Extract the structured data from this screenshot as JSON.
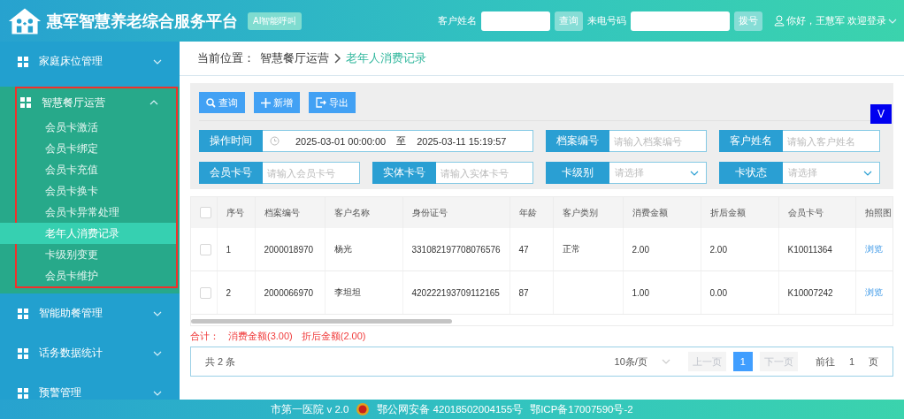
{
  "header": {
    "title": "惠军智慧养老综合服务平台",
    "ai_button": "AI智能呼叫",
    "customer_label": "客户姓名",
    "query_button": "查询",
    "phone_label": "来电号码",
    "dial_button": "拨号",
    "user_greeting": "你好，王慧军 欢迎登录"
  },
  "sidebar": {
    "items": [
      {
        "label": "家庭床位管理",
        "expanded": false
      },
      {
        "label": "智慧餐厅运营",
        "expanded": true,
        "annotated": true,
        "children": [
          {
            "label": "会员卡激活",
            "selected": false
          },
          {
            "label": "会员卡绑定",
            "selected": false
          },
          {
            "label": "会员卡充值",
            "selected": false
          },
          {
            "label": "会员卡换卡",
            "selected": false
          },
          {
            "label": "会员卡异常处理",
            "selected": false
          },
          {
            "label": "老年人消费记录",
            "selected": true
          },
          {
            "label": "卡级别变更",
            "selected": false
          },
          {
            "label": "会员卡维护",
            "selected": false
          }
        ]
      },
      {
        "label": "智能助餐管理",
        "expanded": false
      },
      {
        "label": "话务数据统计",
        "expanded": false
      },
      {
        "label": "预警管理",
        "expanded": false
      }
    ]
  },
  "breadcrumb": {
    "prefix": "当前位置：",
    "parent": "智慧餐厅运营",
    "current": "老年人消费记录"
  },
  "toolbar": {
    "buttons": [
      {
        "kind": "search",
        "label": "查询"
      },
      {
        "kind": "add",
        "label": "新增"
      },
      {
        "kind": "export",
        "label": "导出"
      }
    ],
    "corner_button": "V"
  },
  "filters": [
    {
      "kind": "daterange",
      "label": "操作时间",
      "start": "2025-03-01 00:00:00",
      "separator": "至",
      "end": "2025-03-11 15:19:57"
    },
    {
      "kind": "text",
      "label": "档案编号",
      "placeholder": "请输入档案编号"
    },
    {
      "kind": "text",
      "label": "客户姓名",
      "placeholder": "请输入客户姓名"
    },
    {
      "kind": "text",
      "label": "会员卡号",
      "placeholder": "请输入会员卡号"
    },
    {
      "kind": "text",
      "label": "实体卡号",
      "placeholder": "请输入实体卡号"
    },
    {
      "kind": "select",
      "label": "卡级别",
      "placeholder": "请选择"
    },
    {
      "kind": "select",
      "label": "卡状态",
      "placeholder": "请选择"
    }
  ],
  "table": {
    "all_checked": false,
    "columns": [
      "序号",
      "档案编号",
      "客户名称",
      "身份证号",
      "年龄",
      "客户类别",
      "消费金额",
      "折后金额",
      "会员卡号",
      "拍照图"
    ],
    "rows": [
      {
        "checked": false,
        "cells": [
          "1",
          "2000018970",
          "杨光",
          "331082197708076576",
          "47",
          "正常",
          "2.00",
          "2.00",
          "K10011364"
        ],
        "link": "浏览"
      },
      {
        "checked": false,
        "cells": [
          "2",
          "2000066970",
          "李坦坦",
          "420222193709112165",
          "87",
          "",
          "1.00",
          "0.00",
          "K10007242"
        ],
        "link": "浏览"
      }
    ]
  },
  "summary": {
    "label": "合计：",
    "consumption": "消费金额(3.00)",
    "discounted": "折后金额(2.00)"
  },
  "pagination": {
    "total": "共 2 条",
    "page_size": "10条/页",
    "prev": "上一页",
    "pages": [
      {
        "label": "1",
        "selected": true
      }
    ],
    "next": "下一页",
    "goto_label": "前往",
    "goto_value": "1",
    "goto_unit": "页"
  },
  "footer": {
    "org": "市第一医院 v 2.0",
    "police": "鄂公网安备 42018502004155号",
    "icp": "鄂ICP备17007590号-2"
  }
}
